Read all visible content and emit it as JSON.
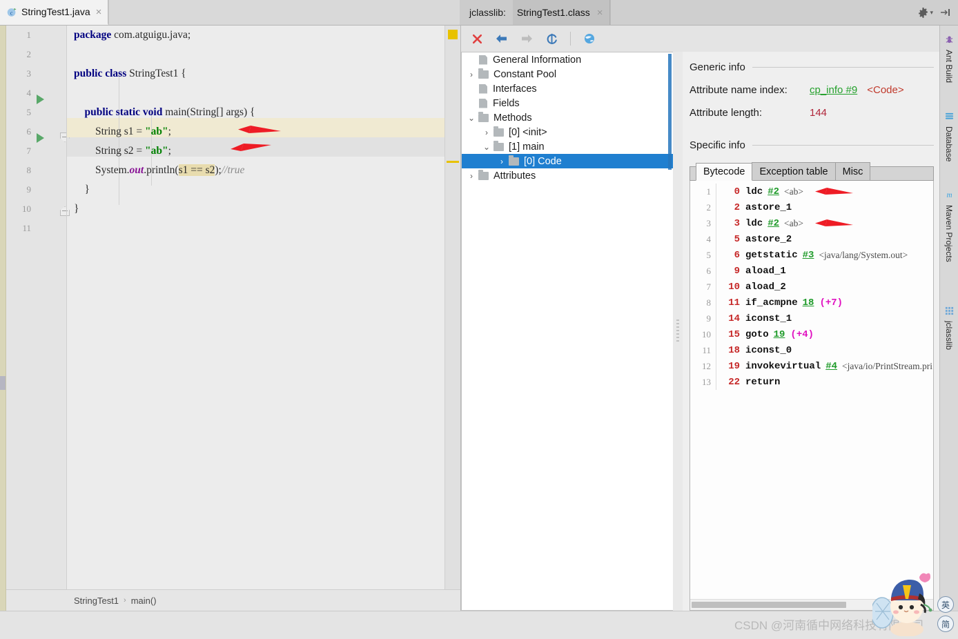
{
  "editor_tab": {
    "title": "StringTest1.java",
    "close": "×",
    "icon": "java-class-icon"
  },
  "jclasslib_tab": {
    "prefix": "jclasslib:",
    "title": "StringTest1.class",
    "close": "×"
  },
  "window_tools": {
    "settings": "gear-icon",
    "settings_caret": "▾",
    "hide": "hide-side-panel-icon"
  },
  "editor": {
    "line_numbers": [
      "1",
      "2",
      "3",
      "4",
      "5",
      "6",
      "7",
      "8",
      "9",
      "10",
      "11"
    ],
    "lines": [
      {
        "n": 1,
        "segments": [
          {
            "t": "package ",
            "c": "kw"
          },
          {
            "t": "com.atguigu.java;",
            "c": ""
          }
        ]
      },
      {
        "n": 2,
        "segments": []
      },
      {
        "n": 3,
        "segments": [
          {
            "t": "public class ",
            "c": "kw"
          },
          {
            "t": "StringTest1 {",
            "c": ""
          }
        ]
      },
      {
        "n": 4,
        "segments": []
      },
      {
        "n": 5,
        "segments": [
          {
            "t": "    public static void ",
            "c": "kw"
          },
          {
            "t": "main(String[] args) {",
            "c": ""
          }
        ]
      },
      {
        "n": 6,
        "segments": [
          {
            "t": "        String s1 = ",
            "c": ""
          },
          {
            "t": "\"ab\"",
            "c": "str"
          },
          {
            "t": ";",
            "c": ""
          }
        ]
      },
      {
        "n": 7,
        "segments": [
          {
            "t": "        String s2 = ",
            "c": ""
          },
          {
            "t": "\"ab\"",
            "c": "str"
          },
          {
            "t": ";",
            "c": ""
          }
        ]
      },
      {
        "n": 8,
        "segments": [
          {
            "t": "        System.",
            "c": ""
          },
          {
            "t": "out",
            "c": "fld"
          },
          {
            "t": ".println(",
            "c": ""
          },
          {
            "t": "s1 == s2",
            "c": "ident-hl"
          },
          {
            "t": ");",
            "c": ""
          },
          {
            "t": "//true",
            "c": "cmt"
          }
        ]
      },
      {
        "n": 9,
        "segments": [
          {
            "t": "    }",
            "c": ""
          }
        ]
      },
      {
        "n": 10,
        "segments": [
          {
            "t": "}",
            "c": ""
          }
        ]
      },
      {
        "n": 11,
        "segments": []
      }
    ],
    "run_markers_on_lines": [
      3,
      5
    ],
    "highlighted_line": 6,
    "caret_line": 7,
    "annotation_arrows": 2
  },
  "breadcrumb": {
    "class": "StringTest1",
    "separator": "›",
    "method": "main()"
  },
  "jcl_toolbar": {
    "close": "close-icon",
    "back": "back-arrow-icon",
    "forward": "forward-arrow-icon",
    "reload": "reload-icon",
    "browse": "globe-icon"
  },
  "tree": {
    "items": [
      {
        "label": "General Information",
        "indent": 0,
        "twisty": "",
        "icon": "file-icon",
        "selected": false
      },
      {
        "label": "Constant Pool",
        "indent": 0,
        "twisty": "›",
        "icon": "folder-icon",
        "selected": false
      },
      {
        "label": "Interfaces",
        "indent": 0,
        "twisty": "",
        "icon": "file-icon",
        "selected": false
      },
      {
        "label": "Fields",
        "indent": 0,
        "twisty": "",
        "icon": "file-icon",
        "selected": false
      },
      {
        "label": "Methods",
        "indent": 0,
        "twisty": "⌄",
        "icon": "folder-icon",
        "selected": false
      },
      {
        "label": "[0] <init>",
        "indent": 1,
        "twisty": "›",
        "icon": "folder-icon",
        "selected": false
      },
      {
        "label": "[1] main",
        "indent": 1,
        "twisty": "⌄",
        "icon": "folder-icon",
        "selected": false
      },
      {
        "label": "[0] Code",
        "indent": 2,
        "twisty": "›",
        "icon": "folder-icon",
        "selected": true
      },
      {
        "label": "Attributes",
        "indent": 0,
        "twisty": "›",
        "icon": "folder-icon",
        "selected": false
      }
    ]
  },
  "detail": {
    "generic_info_title": "Generic info",
    "attr_name_index_label": "Attribute name index:",
    "attr_name_index_link": "cp_info #9",
    "attr_name_index_tag": "<Code>",
    "attr_length_label": "Attribute length:",
    "attr_length_value": "144",
    "specific_info_title": "Specific info",
    "tabs": [
      {
        "label": "Bytecode",
        "active": true
      },
      {
        "label": "Exception table",
        "active": false
      },
      {
        "label": "Misc",
        "active": false
      }
    ]
  },
  "bytecode": {
    "rows": [
      {
        "ln": "1",
        "offset": "0",
        "op": "ldc",
        "ref": "#2",
        "comment": "<ab>",
        "branch": "",
        "arrow": true,
        "sel": false
      },
      {
        "ln": "2",
        "offset": "2",
        "op": "astore_1",
        "ref": "",
        "comment": "",
        "branch": "",
        "arrow": false,
        "sel": false
      },
      {
        "ln": "3",
        "offset": "3",
        "op": "ldc",
        "ref": "#2",
        "comment": "<ab>",
        "branch": "",
        "arrow": true,
        "sel": false
      },
      {
        "ln": "4",
        "offset": "5",
        "op": "astore_2",
        "ref": "",
        "comment": "",
        "branch": "",
        "arrow": false,
        "sel": true
      },
      {
        "ln": "5",
        "offset": "6",
        "op": "getstatic",
        "ref": "#3",
        "comment": "<java/lang/System.out>",
        "branch": "",
        "arrow": false,
        "sel": false
      },
      {
        "ln": "6",
        "offset": "9",
        "op": "aload_1",
        "ref": "",
        "comment": "",
        "branch": "",
        "arrow": false,
        "sel": false
      },
      {
        "ln": "7",
        "offset": "10",
        "op": "aload_2",
        "ref": "",
        "comment": "",
        "branch": "",
        "arrow": false,
        "sel": false
      },
      {
        "ln": "8",
        "offset": "11",
        "op": "if_acmpne",
        "ref": "18",
        "comment": "",
        "branch": "(+7)",
        "arrow": false,
        "sel": false
      },
      {
        "ln": "9",
        "offset": "14",
        "op": "iconst_1",
        "ref": "",
        "comment": "",
        "branch": "",
        "arrow": false,
        "sel": false
      },
      {
        "ln": "10",
        "offset": "15",
        "op": "goto",
        "ref": "19",
        "comment": "",
        "branch": "(+4)",
        "arrow": false,
        "sel": false
      },
      {
        "ln": "11",
        "offset": "18",
        "op": "iconst_0",
        "ref": "",
        "comment": "",
        "branch": "",
        "arrow": false,
        "sel": false
      },
      {
        "ln": "12",
        "offset": "19",
        "op": "invokevirtual",
        "ref": "#4",
        "comment": "<java/io/PrintStream.pri",
        "branch": "",
        "arrow": false,
        "sel": false
      },
      {
        "ln": "13",
        "offset": "22",
        "op": "return",
        "ref": "",
        "comment": "",
        "branch": "",
        "arrow": false,
        "sel": false
      }
    ]
  },
  "right_stripe": {
    "tabs": [
      {
        "label": "Ant Build",
        "icon": "ant-icon"
      },
      {
        "label": "Database",
        "icon": "database-icon"
      },
      {
        "label": "Maven Projects",
        "icon": "maven-icon"
      },
      {
        "label": "jclasslib",
        "icon": "jclasslib-icon"
      }
    ]
  },
  "watermark": {
    "text": "CSDN @河南循中网络科技有限公司"
  },
  "ime": {
    "lang_button": "英",
    "shape_button": "简"
  },
  "colors": {
    "selection_blue": "#1f7fd0",
    "keyword": "#000080",
    "string": "#008000",
    "field": "#871094",
    "comment": "#8c8c8c",
    "bytecode_offset": "#c62828",
    "bytecode_ref": "#1f9b2a",
    "branch": "#e010c0",
    "link_green": "#23a02b",
    "code_tag_red": "#c0392b",
    "number_red": "#b0263a",
    "annotation_arrow": "#ee1c25",
    "marker_yellow": "#e8c200",
    "run_green": "#59a869"
  }
}
